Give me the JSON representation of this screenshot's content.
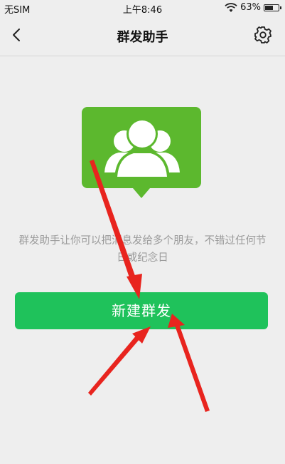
{
  "status_bar": {
    "carrier": "无SIM",
    "time": "上午8:46",
    "battery_percent": "63%",
    "battery_level": 0.63,
    "wifi_icon": "wifi-icon",
    "battery_icon": "battery-icon"
  },
  "nav": {
    "back_icon": "chevron-left-icon",
    "title": "群发助手",
    "settings_icon": "gear-icon"
  },
  "illustration": {
    "icon": "group-people-icon",
    "color": "#5cb82e"
  },
  "description": "群发助手让你可以把消息发给多个朋友，不错过任何节日或纪念日",
  "primary_button": {
    "label": "新建群发",
    "color": "#1fc25b"
  },
  "annotation": {
    "arrow_color": "#e8241e"
  }
}
